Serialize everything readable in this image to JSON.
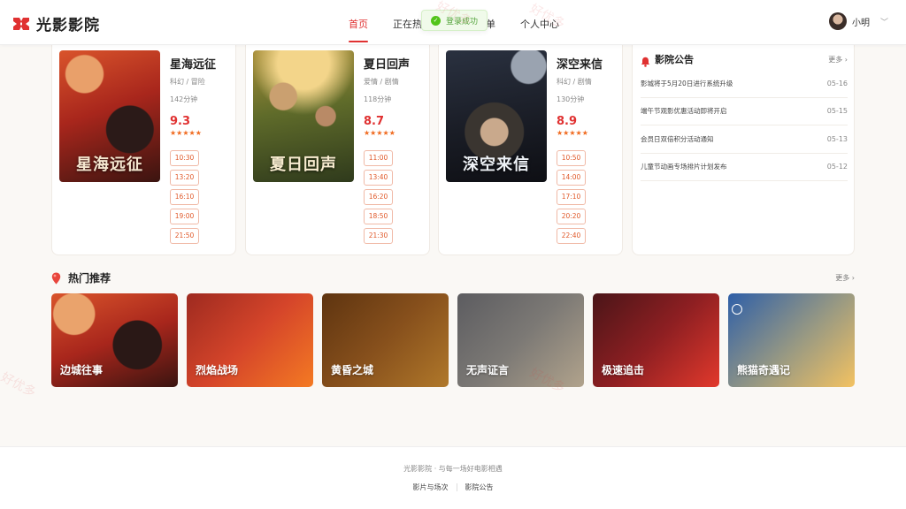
{
  "header": {
    "logo_text": "光影影院",
    "nav": [
      "首页",
      "正在热映",
      "我的订单",
      "个人中心"
    ],
    "user_name": "小明",
    "toast": "登录成功"
  },
  "movies": [
    {
      "title": "星海远征",
      "genre": "科幻 / 冒险",
      "duration": "142分钟",
      "score": "9.3",
      "stars": "★★★★★",
      "poster_text": "星海远征",
      "showtimes": [
        "10:30",
        "13:20",
        "16:10",
        "19:00",
        "21:50"
      ]
    },
    {
      "title": "夏日回声",
      "genre": "爱情 / 剧情",
      "duration": "118分钟",
      "score": "8.7",
      "stars": "★★★★★",
      "poster_text": "夏日回声",
      "showtimes": [
        "11:00",
        "13:40",
        "16:20",
        "18:50",
        "21:30"
      ]
    },
    {
      "title": "深空来信",
      "genre": "科幻 / 剧情",
      "duration": "130分钟",
      "score": "8.9",
      "stars": "★★★★★",
      "poster_text": "深空来信",
      "showtimes": [
        "10:50",
        "14:00",
        "17:10",
        "20:20",
        "22:40"
      ]
    }
  ],
  "announcements": {
    "title": "影院公告",
    "more": "更多 ›",
    "items": [
      {
        "text": "影城将于5月20日进行系统升级",
        "date": "05-16"
      },
      {
        "text": "端午节观影优惠活动即将开启",
        "date": "05-15"
      },
      {
        "text": "会员日双倍积分活动通知",
        "date": "05-13"
      },
      {
        "text": "儿童节动画专场排片计划发布",
        "date": "05-12"
      }
    ]
  },
  "hot": {
    "title": "热门推荐",
    "more": "更多 ›",
    "items": [
      "边城往事",
      "烈焰战场",
      "黄昏之城",
      "无声证言",
      "极速追击",
      "熊猫奇遇记"
    ]
  },
  "footer": {
    "tagline": "光影影院 · 与每一场好电影相遇",
    "links": [
      "影片与场次",
      "影院公告"
    ]
  },
  "watermark": "好优多",
  "colors": {
    "accent": "#e03131",
    "orange": "#f06a1f",
    "background": "#faf8f5"
  }
}
